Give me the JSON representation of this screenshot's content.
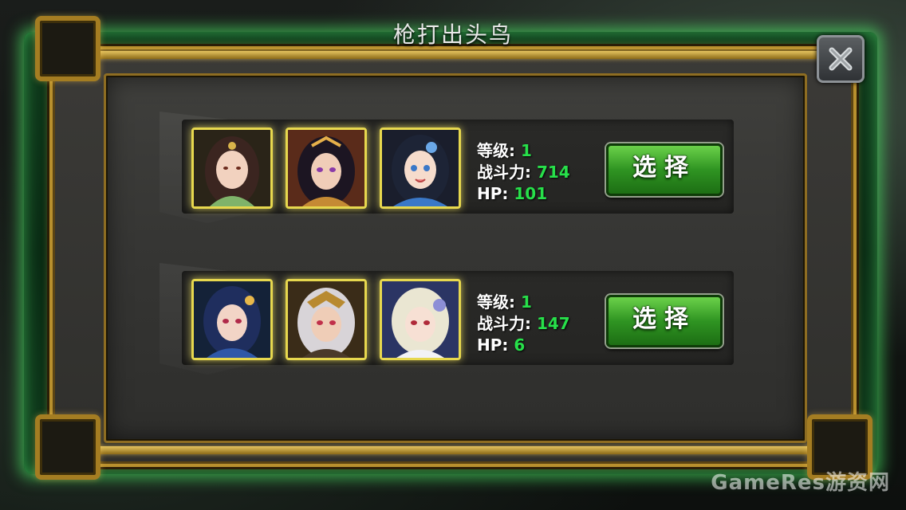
{
  "dialog": {
    "title": "枪打出头鸟"
  },
  "close_button": {
    "icon": "close-x-icon"
  },
  "teams": [
    {
      "portraits": [
        {
          "icon": "hero-portrait-1",
          "hair": "#3b2520",
          "skin": "#f2d2bf",
          "accent": "#7fb36a"
        },
        {
          "icon": "hero-portrait-2",
          "hair": "#1c1522",
          "skin": "#f0cdb8",
          "accent": "#c58a34"
        },
        {
          "icon": "hero-portrait-3",
          "hair": "#1d2436",
          "skin": "#f6dccc",
          "accent": "#3a78c8"
        }
      ],
      "level_label": "等级: ",
      "level_value": "1",
      "power_label": "战斗力: ",
      "power_value": "714",
      "hp_label": "HP: ",
      "hp_value": "101",
      "select_label": "选择"
    },
    {
      "portraits": [
        {
          "icon": "hero-portrait-4",
          "hair": "#1f2e5e",
          "skin": "#f2d4c6",
          "accent": "#2f58a8"
        },
        {
          "icon": "hero-portrait-5",
          "hair": "#d8d4d8",
          "skin": "#efcdb7",
          "accent": "#b88a30"
        },
        {
          "icon": "hero-portrait-6",
          "hair": "#eae6d2",
          "skin": "#f7e0d4",
          "accent": "#8d8fd6"
        }
      ],
      "level_label": "等级: ",
      "level_value": "1",
      "power_label": "战斗力: ",
      "power_value": "147",
      "hp_label": "HP: ",
      "hp_value": "6",
      "select_label": "选择"
    }
  ],
  "watermark": "GameRes游资网"
}
